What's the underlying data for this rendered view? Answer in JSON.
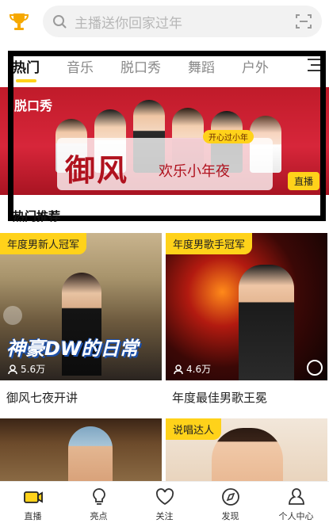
{
  "search": {
    "placeholder": "主播送你回家过年"
  },
  "tabs": [
    {
      "label": "热门",
      "active": true
    },
    {
      "label": "音乐",
      "active": false
    },
    {
      "label": "脱口秀",
      "active": false
    },
    {
      "label": "舞蹈",
      "active": false
    },
    {
      "label": "户外",
      "active": false
    }
  ],
  "banner": {
    "logo": "脱口秀",
    "title": "御风",
    "subtitle": "欢乐小年夜",
    "tag": "开心过小年",
    "badge": "直播"
  },
  "section": {
    "title": "热门推荐"
  },
  "cards": [
    {
      "badge": "年度男新人冠军",
      "overlay": "神豪DW的日常",
      "views": "5.6万",
      "caption": "御风七夜开讲"
    },
    {
      "badge": "年度男歌手冠军",
      "overlay": "",
      "views": "4.6万",
      "caption": "年度最佳男歌王冕"
    },
    {
      "badge": "",
      "overlay": "",
      "views": "",
      "caption": ""
    },
    {
      "badge": "说唱达人",
      "overlay": "",
      "views": "",
      "caption": ""
    }
  ],
  "nav": [
    {
      "label": "直播",
      "icon": "tv-icon",
      "active": true
    },
    {
      "label": "亮点",
      "icon": "bulb-icon",
      "active": false
    },
    {
      "label": "关注",
      "icon": "heart-icon",
      "active": false
    },
    {
      "label": "发现",
      "icon": "compass-icon",
      "active": false
    },
    {
      "label": "个人中心",
      "icon": "user-icon",
      "active": false
    }
  ],
  "colors": {
    "accent": "#ffd21a",
    "banner": "#c01b2a"
  }
}
